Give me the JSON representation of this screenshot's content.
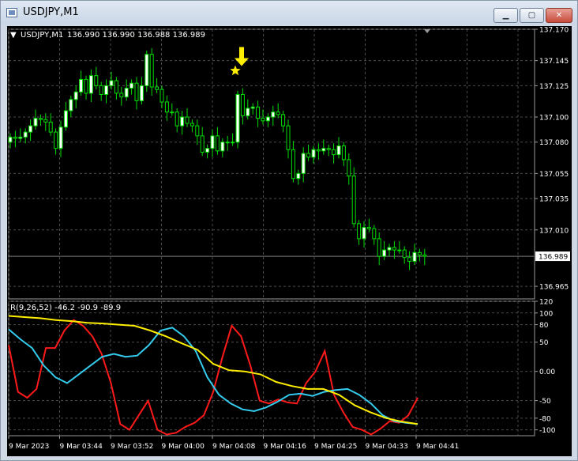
{
  "window": {
    "title": "USDJPY,M1",
    "buttons": [
      {
        "name": "minimize",
        "glyph": "▁"
      },
      {
        "name": "maximize",
        "glyph": "▢"
      },
      {
        "name": "close",
        "glyph": "✕"
      }
    ]
  },
  "colors": {
    "background": "#000000",
    "grid": "#4d4d4d",
    "bull_candle": "#ffffff",
    "bear_candle": "#000000",
    "candle_wick": "#00e000",
    "axis_text": "#ffffff",
    "price_line": "#7a7a7a",
    "indicator_red": "#ff1a1a",
    "indicator_cyan": "#33ccee",
    "indicator_yellow": "#ffee00",
    "signal_arrow": "#ffee00"
  },
  "main_chart": {
    "symbol_label": "USDJPY,M1",
    "ohlc_text": "136.990 136.990 136.988 136.989",
    "current_price": "136.989",
    "signal_marker": "buy-arrow-and-star"
  },
  "indicator": {
    "label": "R(9,26,52) -46.2 -90.9 -89.9"
  },
  "chart_data": [
    {
      "type": "candlestick",
      "title": "USDJPY,M1",
      "ylim": [
        136.955,
        137.17
      ],
      "y_ticks": [
        "137.170",
        "137.145",
        "137.125",
        "137.100",
        "137.080",
        "137.055",
        "137.035",
        "137.010",
        "136.989",
        "136.965"
      ],
      "x_ticks": [
        "9 Mar 2023",
        "9 Mar 03:44",
        "9 Mar 03:52",
        "9 Mar 04:00",
        "9 Mar 04:08",
        "9 Mar 04:16",
        "9 Mar 04:25",
        "9 Mar 04:33",
        "9 Mar 04:41"
      ],
      "last_price": 136.989,
      "candles_close": [
        137.084,
        137.083,
        137.084,
        137.088,
        137.093,
        137.099,
        137.098,
        137.096,
        137.088,
        137.075,
        137.092,
        137.105,
        137.114,
        137.12,
        137.13,
        137.119,
        137.133,
        137.125,
        137.118,
        137.125,
        137.129,
        137.119,
        137.116,
        137.123,
        137.127,
        137.113,
        137.125,
        137.15,
        137.124,
        137.122,
        137.112,
        137.104,
        137.104,
        137.093,
        137.1,
        137.095,
        137.093,
        137.085,
        137.072,
        137.075,
        137.085,
        137.073,
        137.08,
        137.08,
        137.08,
        137.118,
        137.101,
        137.107,
        137.108,
        137.099,
        137.097,
        137.1,
        137.104,
        137.102,
        137.093,
        137.074,
        137.051,
        137.055,
        137.071,
        137.068,
        137.074,
        137.073,
        137.075,
        137.074,
        137.07,
        137.077,
        137.066,
        137.053,
        137.015,
        137.003,
        137.012,
        137.011,
        137.003,
        136.989,
        136.994,
        136.996,
        136.994,
        136.994,
        136.988,
        136.985,
        136.992,
        136.99,
        136.989
      ],
      "signal": {
        "type": "buy",
        "color": "#ffee00"
      }
    },
    {
      "type": "line",
      "title": "R(9,26,52)",
      "ylim": [
        -110,
        120
      ],
      "y_ticks": [
        "120",
        "100",
        "80",
        "50",
        "0.00",
        "-50",
        "-80",
        "-100"
      ],
      "current_values": [
        -46.2,
        -90.9,
        -89.9
      ],
      "series": [
        {
          "color": "#ff1a1a",
          "values": [
            45,
            -35,
            -45,
            -30,
            40,
            40,
            70,
            88,
            78,
            60,
            30,
            -20,
            -90,
            -100,
            -75,
            -50,
            -100,
            -108,
            -105,
            -95,
            -88,
            -75,
            -35,
            25,
            78,
            60,
            10,
            -50,
            -55,
            -48,
            -53,
            -55,
            -20,
            0,
            35,
            -40,
            -70,
            -95,
            -100,
            -108,
            -98,
            -85,
            -88,
            -75,
            -45
          ]
        },
        {
          "color": "#33ccee",
          "values": [
            72,
            55,
            40,
            10,
            -10,
            -20,
            -5,
            10,
            25,
            30,
            25,
            27,
            45,
            70,
            75,
            60,
            35,
            -10,
            -40,
            -55,
            -65,
            -68,
            -62,
            -52,
            -40,
            -38,
            -42,
            -35,
            -32,
            -30,
            -40,
            -55,
            -75,
            -85,
            -88,
            -90
          ]
        },
        {
          "color": "#ffee00",
          "values": [
            95,
            93,
            91,
            88,
            86,
            83,
            82,
            80,
            78,
            70,
            60,
            48,
            37,
            13,
            2,
            0,
            -5,
            -18,
            -25,
            -30,
            -30,
            -40,
            -58,
            -70,
            -80,
            -86,
            -90
          ]
        }
      ]
    }
  ]
}
